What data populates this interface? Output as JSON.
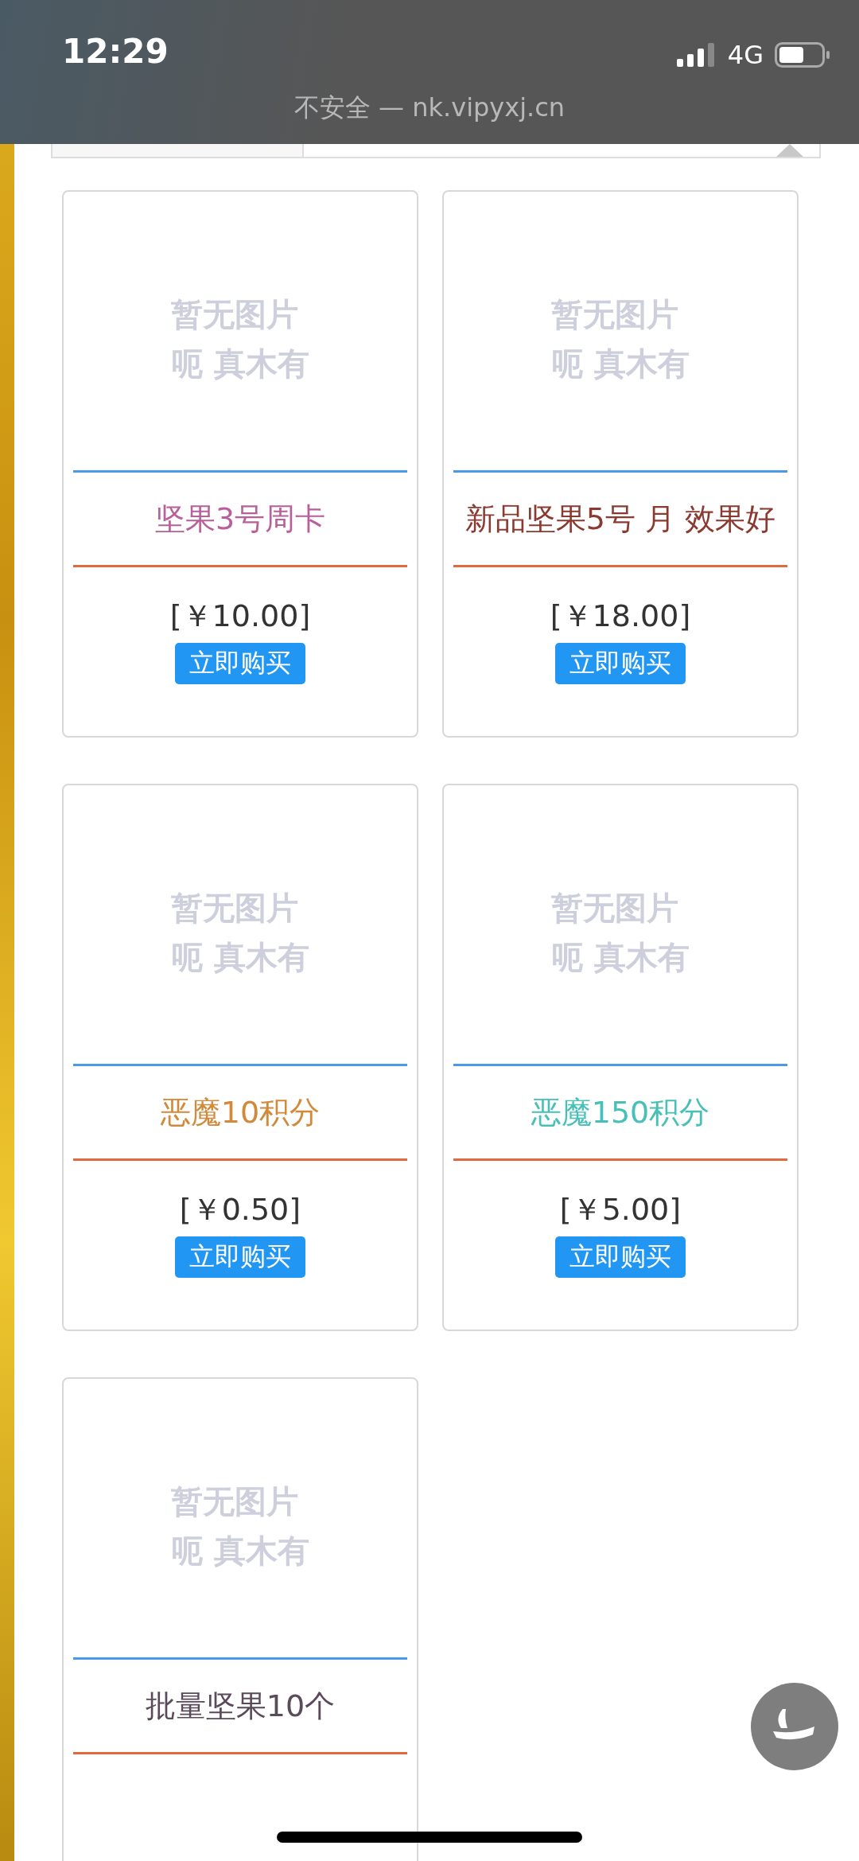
{
  "status_bar": {
    "time": "12:29",
    "network": "4G"
  },
  "browser": {
    "address": "不安全 — nk.vipyxj.cn"
  },
  "products": [
    {
      "no_image_lines": [
        "暂无图片",
        "呃 真木有"
      ],
      "title": "坚果3号周卡",
      "color": "#b8609a",
      "price": "[￥10.00]",
      "button": "立即购买"
    },
    {
      "no_image_lines": [
        "暂无图片",
        "呃 真木有"
      ],
      "title": "新品坚果5号 月 效果好",
      "color": "#8a3a30",
      "price": "[￥18.00]",
      "button": "立即购买"
    },
    {
      "no_image_lines": [
        "暂无图片",
        "呃 真木有"
      ],
      "title": "恶魔10积分",
      "color": "#d08a3a",
      "price": "[￥0.50]",
      "button": "立即购买"
    },
    {
      "no_image_lines": [
        "暂无图片",
        "呃 真木有"
      ],
      "title": "恶魔150积分",
      "color": "#48c0b8",
      "price": "[￥5.00]",
      "button": "立即购买"
    },
    {
      "no_image_lines": [
        "暂无图片",
        "呃 真木有"
      ],
      "title": "批量坚果10个",
      "color": "#5a4a5a"
    }
  ]
}
